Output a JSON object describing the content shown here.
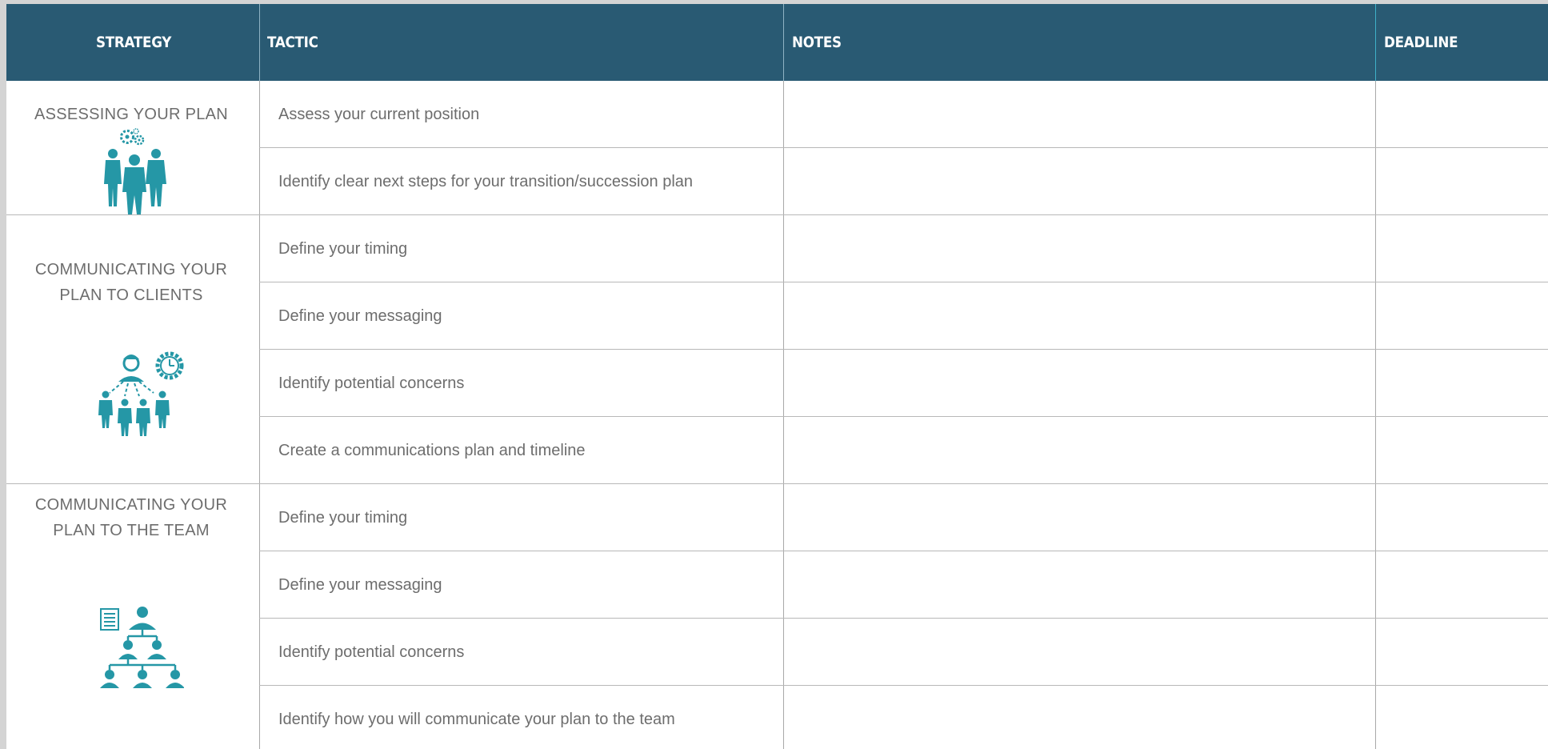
{
  "header": {
    "strategy": "STRATEGY",
    "tactic": "TACTIC",
    "notes": "NOTES",
    "deadline": "DEADLINE"
  },
  "sections": [
    {
      "strategy": "ASSESSING YOUR PLAN",
      "icon": "team-gears-icon",
      "tactics": [
        "Assess your current position",
        "Identify clear next steps for your transition/succession plan"
      ]
    },
    {
      "strategy_line1": "COMMUNICATING YOUR",
      "strategy_line2": "PLAN TO CLIENTS",
      "icon": "manager-clock-team-icon",
      "tactics": [
        "Define your timing",
        "Define your messaging",
        "Identify potential concerns",
        "Create a communications plan and timeline"
      ]
    },
    {
      "strategy_line1": "COMMUNICATING YOUR",
      "strategy_line2": "PLAN TO THE TEAM",
      "icon": "org-chart-document-icon",
      "tactics": [
        "Define your timing",
        "Define your messaging",
        "Identify potential concerns",
        "Identify how you will communicate your plan to the team"
      ]
    }
  ],
  "colors": {
    "header_bg": "#295a73",
    "icon_teal": "#2597a6",
    "text_gray": "#6d6d6d"
  }
}
